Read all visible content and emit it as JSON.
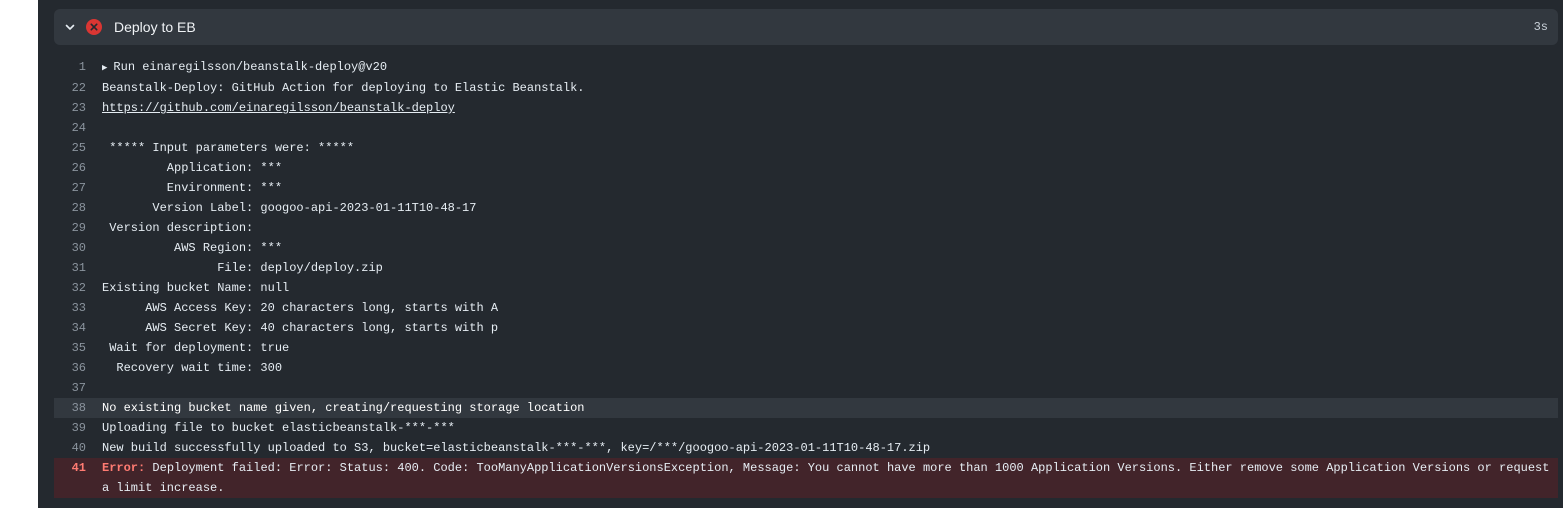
{
  "step": {
    "title": "Deploy to EB",
    "duration": "3s",
    "status_color": "#da3633"
  },
  "log": {
    "run_line": {
      "num": "1",
      "text": "Run einaregilsson/beanstalk-deploy@v20"
    },
    "lines": [
      {
        "num": "22",
        "text": "Beanstalk-Deploy: GitHub Action for deploying to Elastic Beanstalk."
      },
      {
        "num": "23",
        "text": "https://github.com/einaregilsson/beanstalk-deploy"
      },
      {
        "num": "24",
        "text": ""
      },
      {
        "num": "25",
        "text": " ***** Input parameters were: *****"
      },
      {
        "num": "26",
        "text": "         Application: ***"
      },
      {
        "num": "27",
        "text": "         Environment: ***"
      },
      {
        "num": "28",
        "text": "       Version Label: googoo-api-2023-01-11T10-48-17"
      },
      {
        "num": "29",
        "text": " Version description: "
      },
      {
        "num": "30",
        "text": "          AWS Region: ***"
      },
      {
        "num": "31",
        "text": "                File: deploy/deploy.zip"
      },
      {
        "num": "32",
        "text": "Existing bucket Name: null"
      },
      {
        "num": "33",
        "text": "      AWS Access Key: 20 characters long, starts with A"
      },
      {
        "num": "34",
        "text": "      AWS Secret Key: 40 characters long, starts with p"
      },
      {
        "num": "35",
        "text": " Wait for deployment: true"
      },
      {
        "num": "36",
        "text": "  Recovery wait time: 300"
      },
      {
        "num": "37",
        "text": ""
      },
      {
        "num": "38",
        "text": "No existing bucket name given, creating/requesting storage location"
      },
      {
        "num": "39",
        "text": "Uploading file to bucket elasticbeanstalk-***-***"
      },
      {
        "num": "40",
        "text": "New build successfully uploaded to S3, bucket=elasticbeanstalk-***-***, key=/***/googoo-api-2023-01-11T10-48-17.zip"
      }
    ],
    "error_line": {
      "num": "41",
      "label": "Error:",
      "text": " Deployment failed: Error: Status: 400. Code: TooManyApplicationVersionsException, Message: You cannot have more than 1000 Application Versions. Either remove some Application Versions or request a limit increase."
    }
  }
}
